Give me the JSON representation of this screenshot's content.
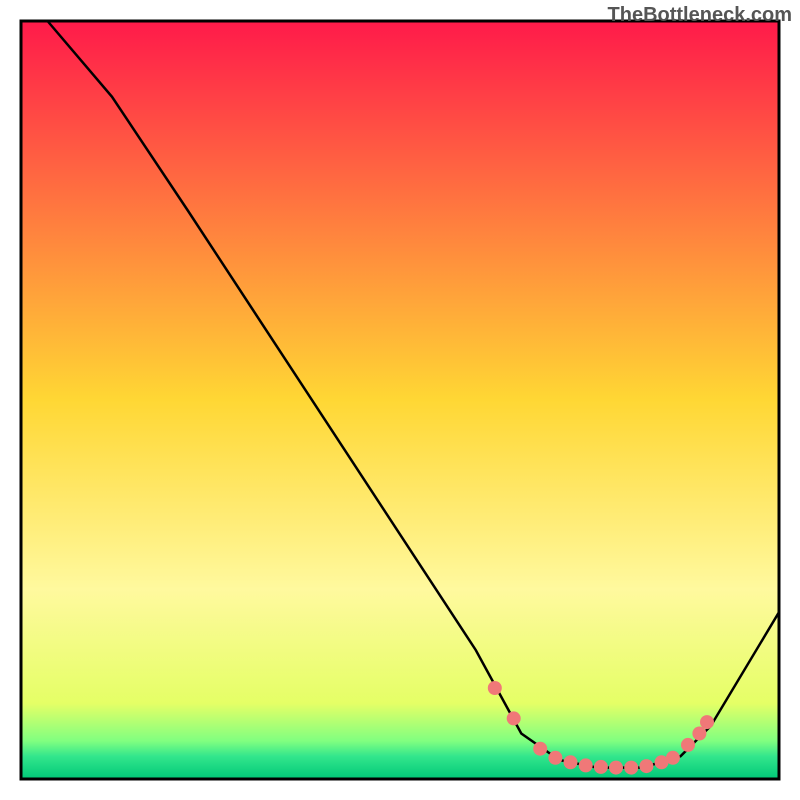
{
  "watermark": "TheBottleneck.com",
  "chart_data": {
    "type": "line",
    "title": "",
    "xlabel": "",
    "ylabel": "",
    "xlim": [
      0,
      100
    ],
    "ylim": [
      0,
      100
    ],
    "background_gradient": {
      "stops": [
        {
          "offset": 0.0,
          "color": "#ff1a4a"
        },
        {
          "offset": 0.5,
          "color": "#ffd734"
        },
        {
          "offset": 0.75,
          "color": "#fff99e"
        },
        {
          "offset": 0.9,
          "color": "#e5ff66"
        },
        {
          "offset": 0.95,
          "color": "#80ff80"
        },
        {
          "offset": 0.97,
          "color": "#33e68c"
        },
        {
          "offset": 1.0,
          "color": "#00c878"
        }
      ]
    },
    "series": [
      {
        "name": "curve",
        "type": "line",
        "color": "#000000",
        "points": [
          {
            "x": 3.5,
            "y": 100
          },
          {
            "x": 12,
            "y": 90
          },
          {
            "x": 22,
            "y": 75
          },
          {
            "x": 60,
            "y": 17
          },
          {
            "x": 66,
            "y": 6
          },
          {
            "x": 71,
            "y": 2.5
          },
          {
            "x": 76,
            "y": 1.5
          },
          {
            "x": 82,
            "y": 1.5
          },
          {
            "x": 87,
            "y": 3
          },
          {
            "x": 91,
            "y": 7
          },
          {
            "x": 100,
            "y": 22
          }
        ]
      },
      {
        "name": "dots",
        "type": "scatter",
        "color": "#f07878",
        "points": [
          {
            "x": 62.5,
            "y": 12
          },
          {
            "x": 65,
            "y": 8
          },
          {
            "x": 68.5,
            "y": 4
          },
          {
            "x": 70.5,
            "y": 2.8
          },
          {
            "x": 72.5,
            "y": 2.2
          },
          {
            "x": 74.5,
            "y": 1.8
          },
          {
            "x": 76.5,
            "y": 1.6
          },
          {
            "x": 78.5,
            "y": 1.5
          },
          {
            "x": 80.5,
            "y": 1.5
          },
          {
            "x": 82.5,
            "y": 1.7
          },
          {
            "x": 84.5,
            "y": 2.2
          },
          {
            "x": 86,
            "y": 2.8
          },
          {
            "x": 88,
            "y": 4.5
          },
          {
            "x": 89.5,
            "y": 6
          },
          {
            "x": 90.5,
            "y": 7.5
          }
        ]
      }
    ]
  }
}
